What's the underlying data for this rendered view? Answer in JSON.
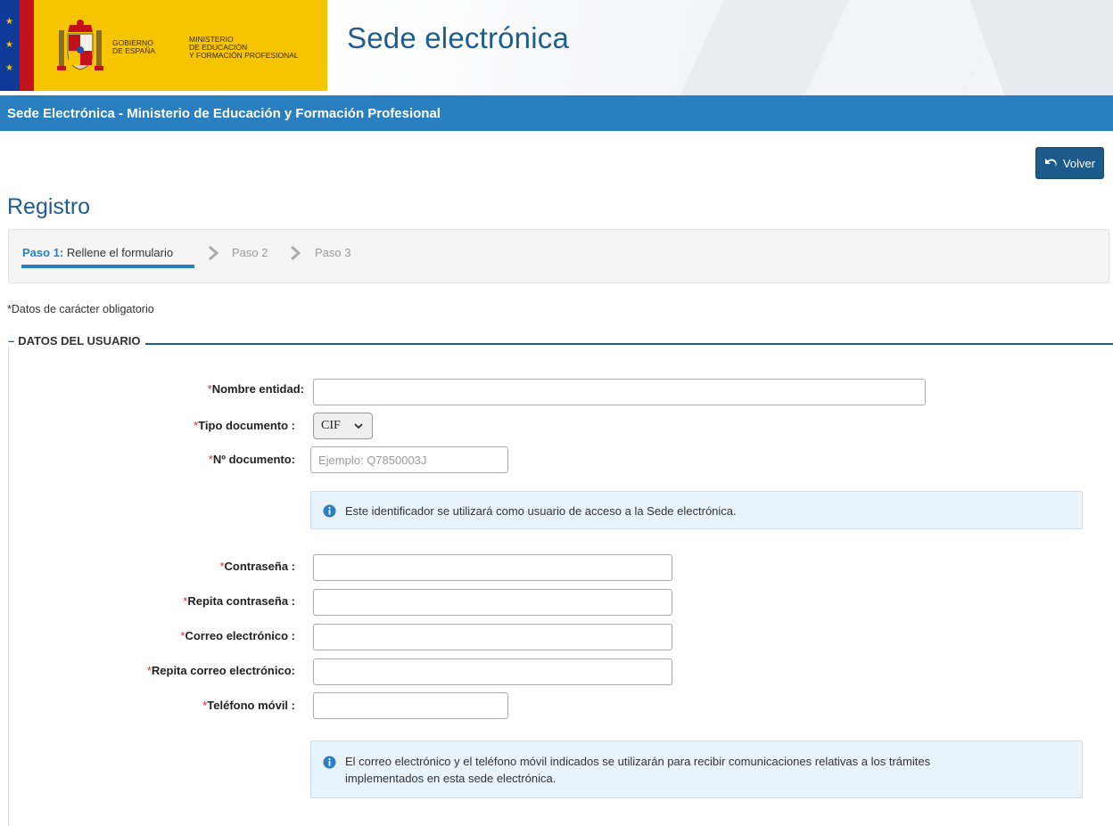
{
  "header": {
    "gov_line1": "GOBIERNO",
    "gov_line2": "DE ESPAÑA",
    "min_line1": "MINISTERIO",
    "min_line2": "DE EDUCACIÓN",
    "min_line3": "Y FORMACIÓN PROFESIONAL",
    "site_title": "Sede electrónica"
  },
  "bluebar": {
    "title": "Sede Electrónica - Ministerio de Educación y Formación Profesional"
  },
  "actions": {
    "back_label": "Volver"
  },
  "page": {
    "title": "Registro",
    "mandatory_note": "*Datos de carácter obligatorio"
  },
  "steps": {
    "step1_label": "Paso 1:",
    "step1_text": " Rellene el formulario",
    "step2": "Paso 2",
    "step3": "Paso 3"
  },
  "form": {
    "legend": "DATOS DEL USUARIO",
    "required_mark": "*",
    "nombre_label": "Nombre entidad:",
    "nombre_value": "",
    "tipo_label": "Tipo documento :",
    "tipo_value": "CIF",
    "ndoc_label": "Nº documento:",
    "ndoc_placeholder": "Ejemplo: Q7850003J",
    "info1": "Este identificador se utilizará como usuario de acceso a la Sede electrónica.",
    "pass_label": "Contraseña :",
    "pass2_label": "Repita contraseña :",
    "email_label": "Correo electrónico :",
    "email2_label": "Repita correo electrónico:",
    "phone_label": "Teléfono móvil :",
    "info2_line1": "El correo electrónico y el teléfono móvil indicados se utilizarán para recibir comunicaciones relativas a los trámites",
    "info2_line2": "implementados en esta sede electrónica."
  },
  "colors": {
    "brand_blue": "#2a7fc0",
    "title_blue": "#1f5d91",
    "logo_yellow": "#f6c500",
    "required_red": "#c9302c"
  }
}
